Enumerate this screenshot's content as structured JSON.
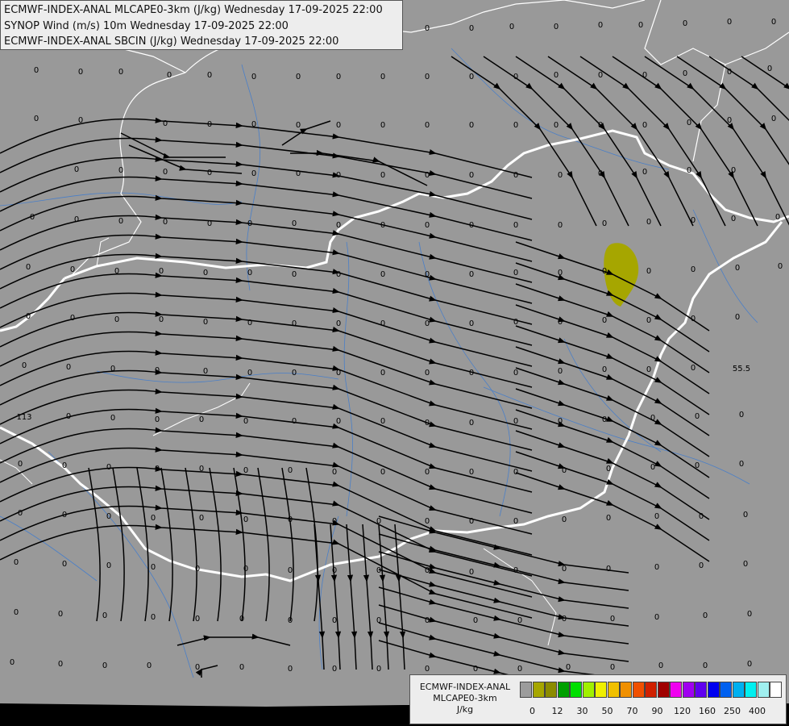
{
  "header": {
    "line1": "ECMWF-INDEX-ANAL MLCAPE0-3km (J/kg) Wednesday 17-09-2025 22:00",
    "line2": "SYNOP Wind (m/s) 10m Wednesday 17-09-2025 22:00",
    "line3": "ECMWF-INDEX-ANAL SBCIN (J/kg) Wednesday 17-09-2025 22:00"
  },
  "legend": {
    "line1": "ECMWF-INDEX-ANAL",
    "line2": "MLCAPE0-3km",
    "line3": "J/kg",
    "colors": [
      "#9c9c9c",
      "#a6a600",
      "#8c8c00",
      "#00a000",
      "#00e000",
      "#a0f000",
      "#f0f000",
      "#f0c000",
      "#f09000",
      "#f05000",
      "#d02000",
      "#a00000",
      "#f000f0",
      "#a000f0",
      "#6000f0",
      "#0000f0",
      "#0060f0",
      "#00b0f0",
      "#00f0f0",
      "#a0f0f0",
      "#ffffff"
    ],
    "tick_labels": [
      {
        "label": "0",
        "index": 1
      },
      {
        "label": "12",
        "index": 3
      },
      {
        "label": "30",
        "index": 5
      },
      {
        "label": "50",
        "index": 7
      },
      {
        "label": "70",
        "index": 9
      },
      {
        "label": "90",
        "index": 11
      },
      {
        "label": "120",
        "index": 13
      },
      {
        "label": "160",
        "index": 15
      },
      {
        "label": "250",
        "index": 17
      },
      {
        "label": "400",
        "index": 19
      }
    ]
  },
  "special_values": [
    {
      "label": "113"
    },
    {
      "label": "55.5"
    }
  ],
  "grid_value": "0"
}
